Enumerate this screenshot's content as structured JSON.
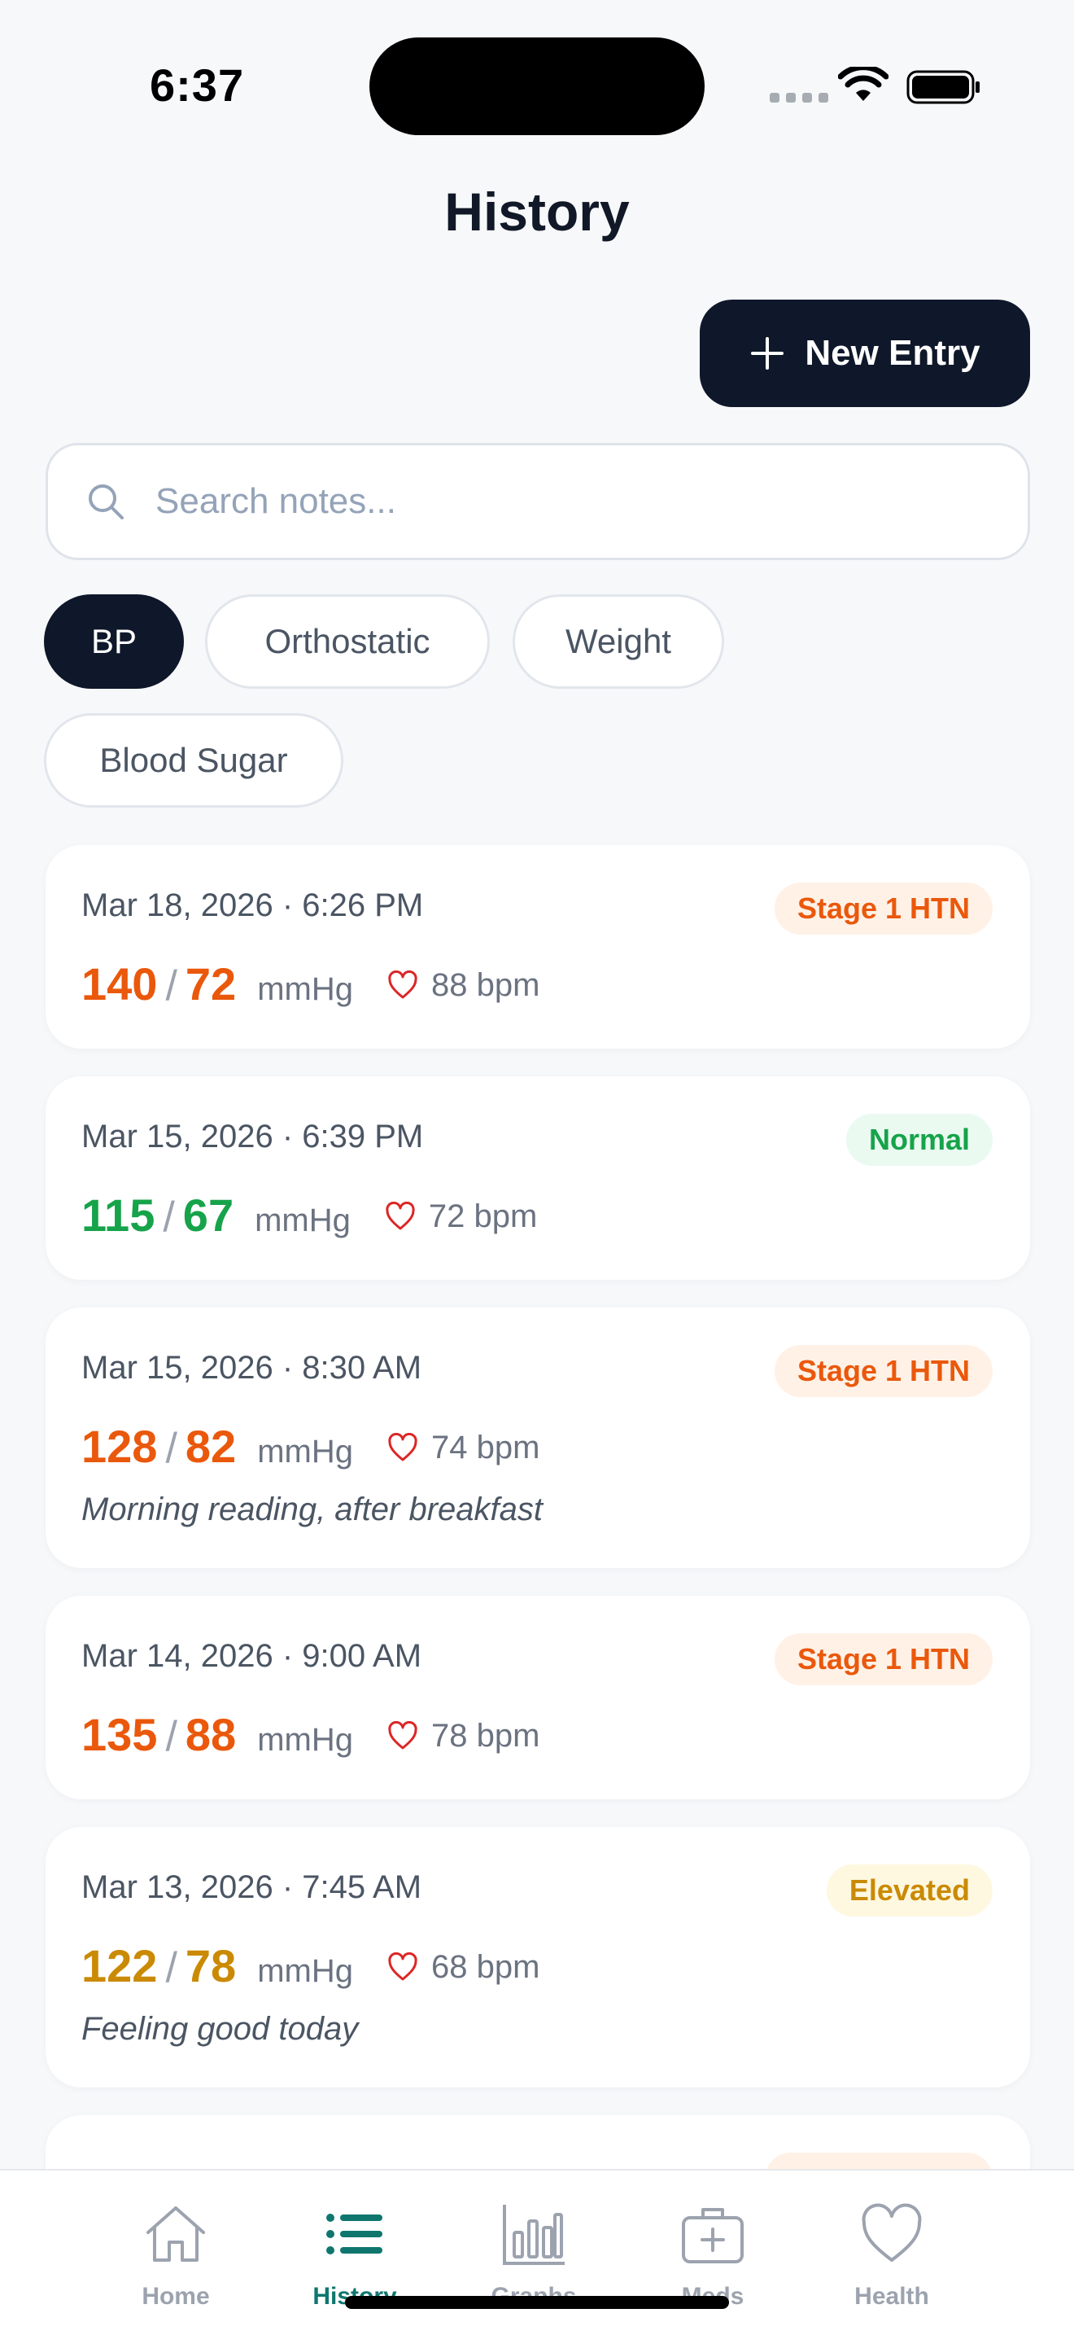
{
  "status_bar": {
    "time": "6:37"
  },
  "header": {
    "title": "History"
  },
  "actions": {
    "new_entry_label": "New Entry"
  },
  "search": {
    "placeholder": "Search notes...",
    "value": ""
  },
  "filters": [
    {
      "label": "BP",
      "active": true
    },
    {
      "label": "Orthostatic",
      "active": false
    },
    {
      "label": "Weight",
      "active": false
    },
    {
      "label": "Blood Sugar",
      "active": false
    }
  ],
  "entries": [
    {
      "date": "Mar 18, 2026 · 6:26 PM",
      "systolic": "140",
      "diastolic": "72",
      "unit": "mmHg",
      "pulse": "88 bpm",
      "status": "Stage 1 HTN",
      "note": ""
    },
    {
      "date": "Mar 15, 2026 · 6:39 PM",
      "systolic": "115",
      "diastolic": "67",
      "unit": "mmHg",
      "pulse": "72 bpm",
      "status": "Normal",
      "note": ""
    },
    {
      "date": "Mar 15, 2026 · 8:30 AM",
      "systolic": "128",
      "diastolic": "82",
      "unit": "mmHg",
      "pulse": "74 bpm",
      "status": "Stage 1 HTN",
      "note": "Morning reading, after breakfast"
    },
    {
      "date": "Mar 14, 2026 · 9:00 AM",
      "systolic": "135",
      "diastolic": "88",
      "unit": "mmHg",
      "pulse": "78 bpm",
      "status": "Stage 1 HTN",
      "note": ""
    },
    {
      "date": "Mar 13, 2026 · 7:45 AM",
      "systolic": "122",
      "diastolic": "78",
      "unit": "mmHg",
      "pulse": "68 bpm",
      "status": "Elevated",
      "note": "Feeling good today"
    }
  ],
  "status_colors": {
    "Stage 1 HTN": {
      "text": "#ea580c",
      "bg": "#fff1e6"
    },
    "Normal": {
      "text": "#16a34a",
      "bg": "#eafaf0"
    },
    "Elevated": {
      "text": "#ca8a04",
      "bg": "#fef8e1"
    }
  },
  "icons": {
    "search": "search-icon",
    "plus": "plus-icon",
    "heart": "heart-icon",
    "wifi": "wifi-icon",
    "battery": "battery-icon"
  },
  "tabbar": {
    "active": "History",
    "items": [
      {
        "label": "Home",
        "icon": "home-icon"
      },
      {
        "label": "History",
        "icon": "list-icon"
      },
      {
        "label": "Graphs",
        "icon": "bar-chart-icon"
      },
      {
        "label": "Meds",
        "icon": "medkit-icon"
      },
      {
        "label": "Health",
        "icon": "heart-icon"
      }
    ]
  },
  "accent_color": "#0f766e"
}
